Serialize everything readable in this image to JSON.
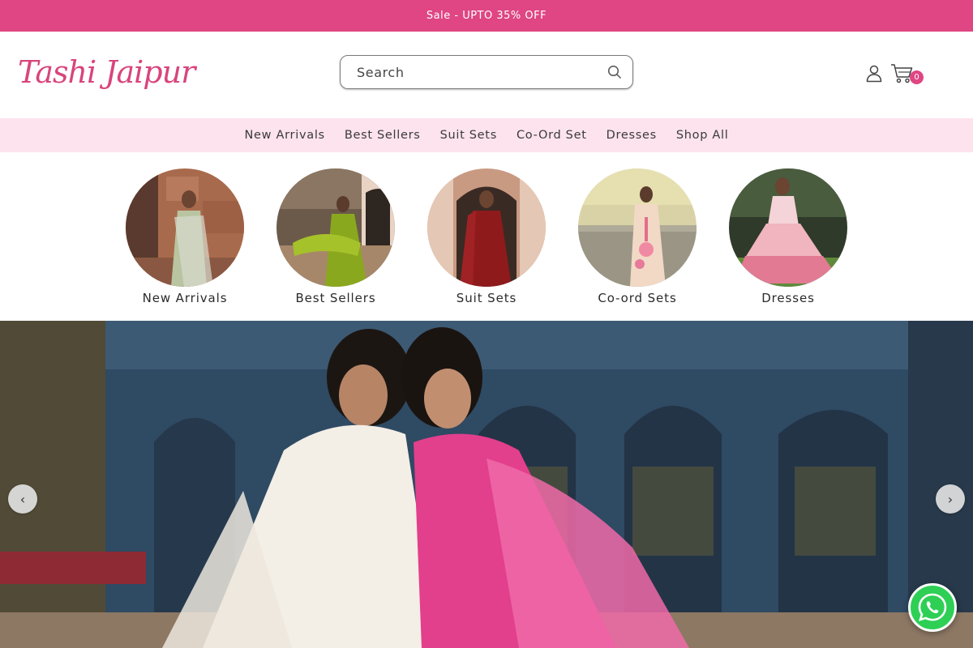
{
  "announcement": {
    "text": "Sale - UPTO 35% OFF"
  },
  "brand": {
    "name": "Tashi Jaipur",
    "color": "#d8457d"
  },
  "search": {
    "placeholder": "Search",
    "icon": "search-icon"
  },
  "header_icons": {
    "account": "user-icon",
    "cart": "cart-icon",
    "cart_count": "0"
  },
  "nav": {
    "items": [
      {
        "label": "New Arrivals"
      },
      {
        "label": "Best Sellers"
      },
      {
        "label": "Suit Sets"
      },
      {
        "label": "Co-Ord Set"
      },
      {
        "label": "Dresses"
      },
      {
        "label": "Shop All"
      }
    ]
  },
  "categories": [
    {
      "label": "New Arrivals"
    },
    {
      "label": "Best Sellers"
    },
    {
      "label": "Suit Sets"
    },
    {
      "label": "Co-ord Sets"
    },
    {
      "label": "Dresses"
    }
  ],
  "hero": {
    "prev": "‹",
    "next": "›"
  },
  "floating": {
    "whatsapp": "whatsapp-icon"
  },
  "colors": {
    "accent": "#df4683",
    "nav_bg": "#fde3ee",
    "whatsapp": "#2ecf55"
  }
}
